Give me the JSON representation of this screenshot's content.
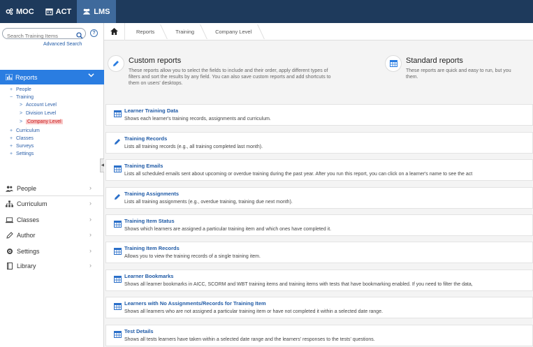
{
  "topnav": {
    "tabs": [
      {
        "label": "MOC",
        "icon": "gears-icon"
      },
      {
        "label": "ACT",
        "icon": "calendar-icon"
      },
      {
        "label": "LMS",
        "icon": "users-icon"
      }
    ],
    "active": "LMS"
  },
  "sidebar": {
    "search_placeholder": "Search Training Items",
    "advanced_search": "Advanced Search",
    "help": "?",
    "reports_label": "Reports",
    "tree": [
      {
        "label": "People",
        "prefix": "+"
      },
      {
        "label": "Training",
        "prefix": "−"
      },
      {
        "label": "Account Level",
        "prefix": ">"
      },
      {
        "label": "Division Level",
        "prefix": ">"
      },
      {
        "label": "Company Level",
        "prefix": ">"
      },
      {
        "label": "Curriculum",
        "prefix": "+"
      },
      {
        "label": "Classes",
        "prefix": "+"
      },
      {
        "label": "Surveys",
        "prefix": "+"
      },
      {
        "label": "Settings",
        "prefix": "+"
      }
    ],
    "menu": [
      {
        "label": "People",
        "icon": "people-icon"
      },
      {
        "label": "Curriculum",
        "icon": "sitemap-icon"
      },
      {
        "label": "Classes",
        "icon": "laptop-icon"
      },
      {
        "label": "Author",
        "icon": "pencil-icon"
      },
      {
        "label": "Settings",
        "icon": "gear-icon"
      },
      {
        "label": "Library",
        "icon": "book-icon"
      }
    ]
  },
  "breadcrumb": [
    "Reports",
    "Training",
    "Company Level"
  ],
  "report_types": {
    "custom": {
      "title": "Custom reports",
      "desc1": "These reports allow you to select the fields to include and their order, apply different types of",
      "desc2": "filters and sort the results by any field. You can also save custom reports and add shortcuts to",
      "desc3": "them on users' desktops."
    },
    "standard": {
      "title": "Standard reports",
      "desc1": "These reports are quick and easy to run, but you",
      "desc2": "them."
    }
  },
  "reports": [
    {
      "title": "Learner Training Data",
      "desc": "Shows each learner's training records, assignments and curriculum.",
      "icon": "grid-icon"
    },
    {
      "title": "Training Records",
      "desc": "Lists all training records (e.g., all training completed last month).",
      "icon": "pencil-icon"
    },
    {
      "title": "Training Emails",
      "desc": "Lists all scheduled emails sent about upcoming or overdue training during the past year. After you run this report, you can click on a learner's name to see the act",
      "icon": "grid-icon"
    },
    {
      "title": "Training Assignments",
      "desc": "Lists all training assignments (e.g., overdue training, training due next month).",
      "icon": "pencil-icon"
    },
    {
      "title": "Training Item Status",
      "desc": "Shows which learners are assigned a particular training item and which ones have completed it.",
      "icon": "grid-icon"
    },
    {
      "title": "Training Item Records",
      "desc": "Allows you to view the training records of a single training item.",
      "icon": "grid-icon"
    },
    {
      "title": "Learner Bookmarks",
      "desc": "Shows all learner bookmarks in AICC, SCORM and WBT training items and training items with tests that have bookmarking enabled. If you need to filter the data,",
      "icon": "grid-icon"
    },
    {
      "title": "Learners with No Assignments/Records for Training Item",
      "desc": "Shows all learners who are not assigned a particular training item or have not completed it within a selected date range.",
      "icon": "grid-icon"
    },
    {
      "title": "Test Details",
      "desc": "Shows all tests learners have taken within a selected date range and the learners' responses to the tests' questions.",
      "icon": "grid-icon"
    }
  ]
}
